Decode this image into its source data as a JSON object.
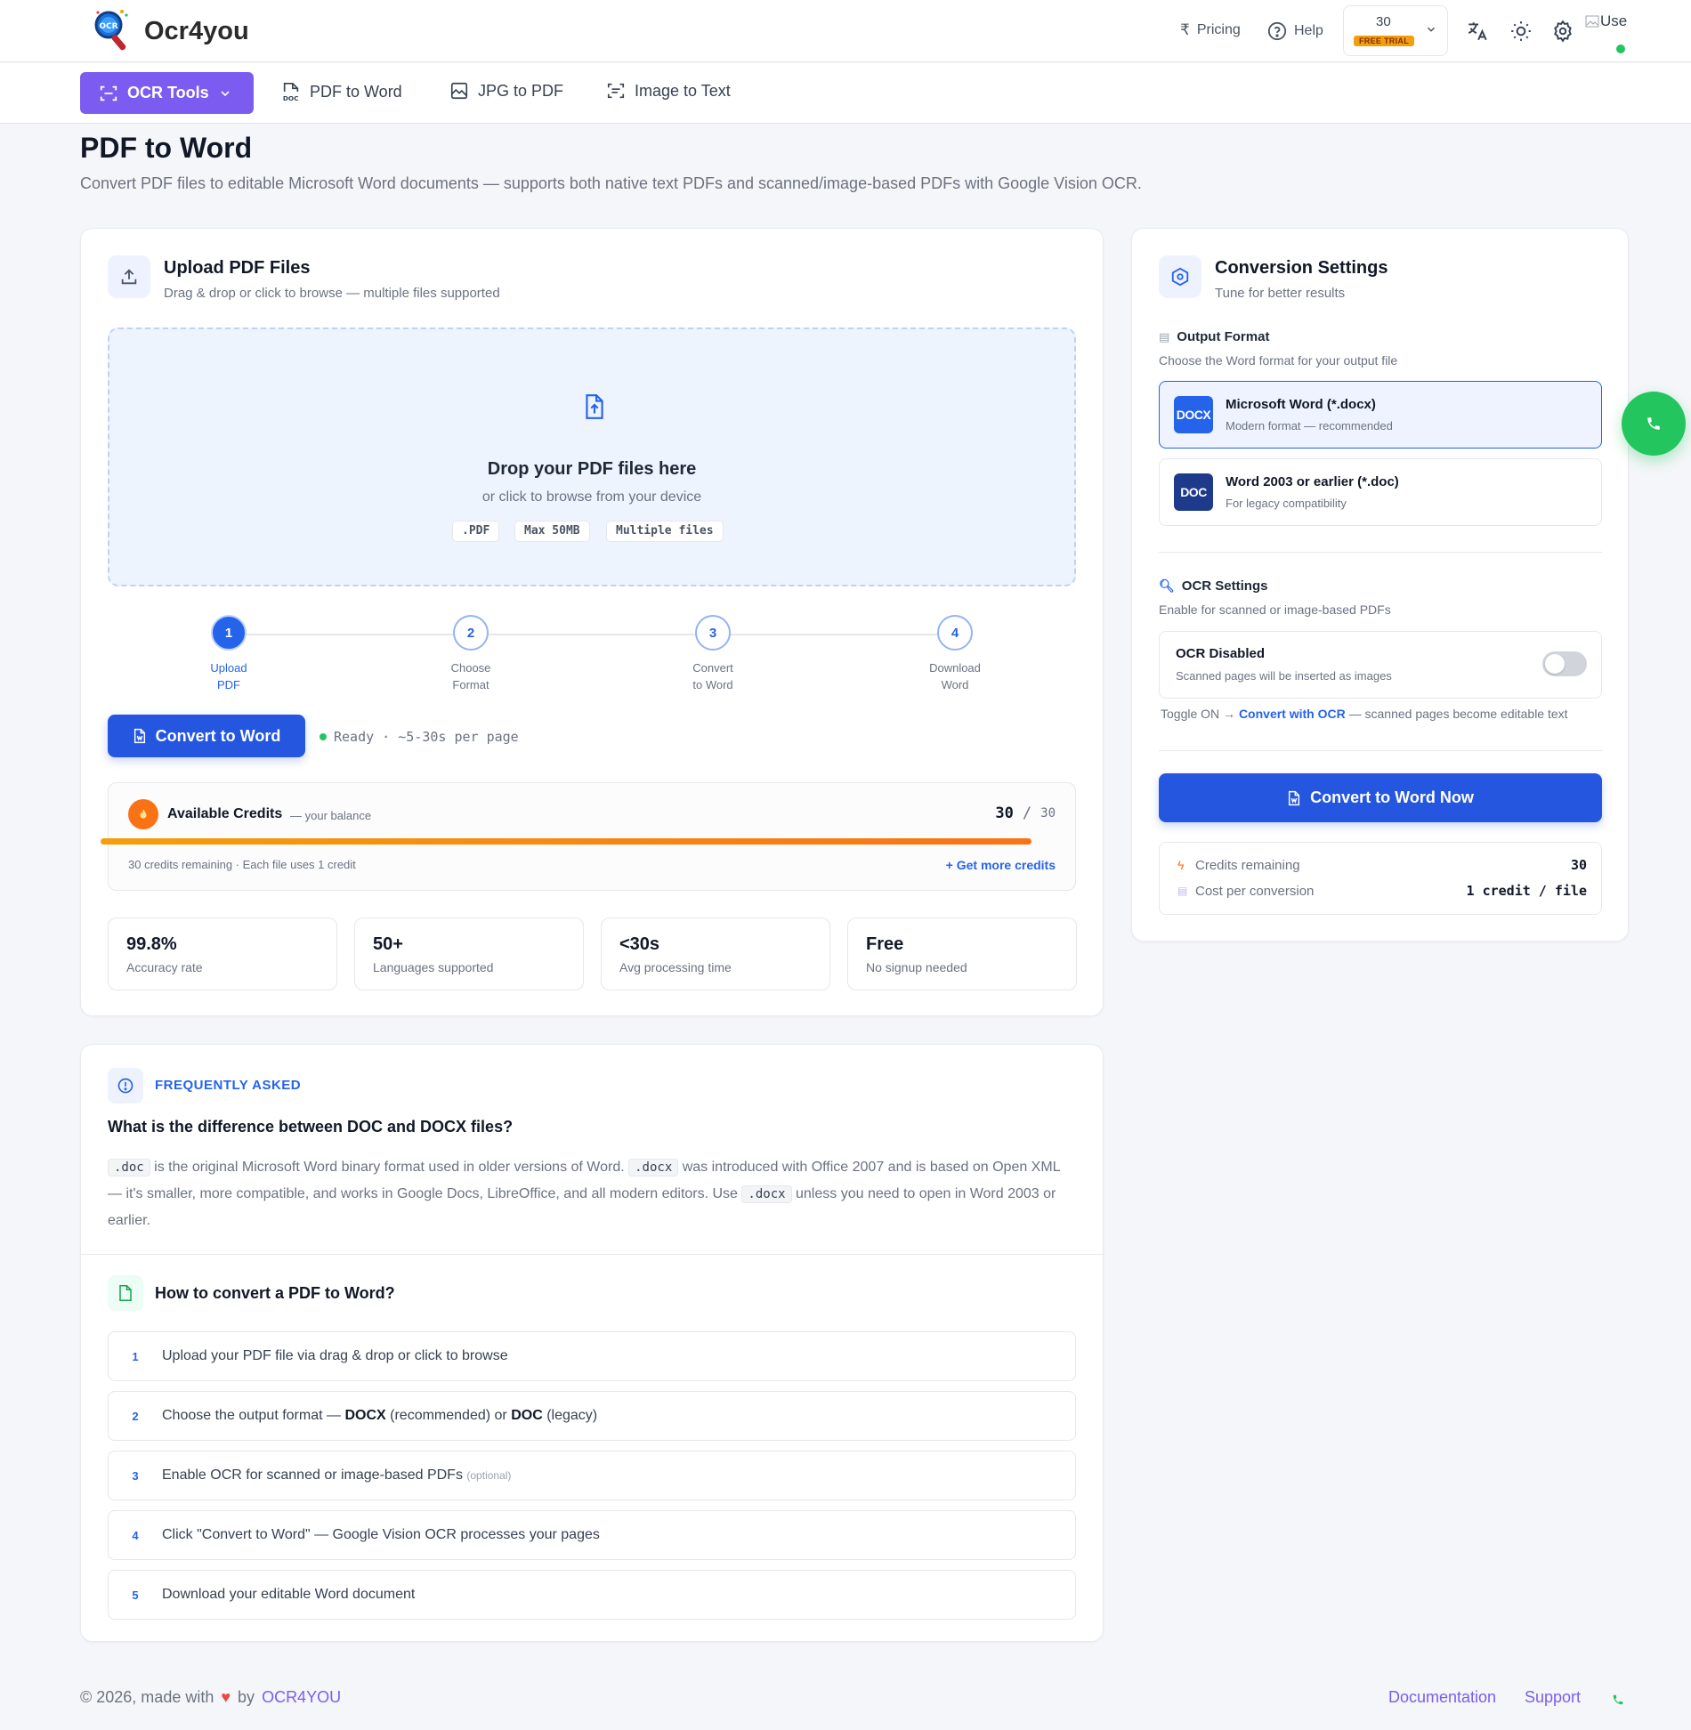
{
  "header": {
    "brand": "Ocr4you",
    "pricing": "Pricing",
    "help": "Help",
    "credits": "30",
    "trial_badge": "FREE TRIAL",
    "avatar_alt": "Use"
  },
  "nav": {
    "ocr_tools": "OCR Tools",
    "items": [
      "PDF to Word",
      "JPG to PDF",
      "Image to Text"
    ]
  },
  "page": {
    "title": "PDF to Word",
    "subtitle": "Convert PDF files to editable Microsoft Word documents — supports both native text PDFs and scanned/image-based PDFs with Google Vision OCR."
  },
  "upload": {
    "title": "Upload PDF Files",
    "subtitle": "Drag & drop or click to browse — multiple files supported",
    "drop_title": "Drop your PDF files here",
    "drop_sub": "or click to browse from your device",
    "chips": [
      ".PDF",
      "Max 50MB",
      "Multiple files"
    ],
    "steps": [
      {
        "num": "1",
        "l1": "Upload",
        "l2": "PDF"
      },
      {
        "num": "2",
        "l1": "Choose",
        "l2": "Format"
      },
      {
        "num": "3",
        "l1": "Convert",
        "l2": "to Word"
      },
      {
        "num": "4",
        "l1": "Download",
        "l2": "Word"
      }
    ],
    "convert_btn": "Convert to Word",
    "status": "Ready · ~5-30s per page"
  },
  "credits": {
    "title": "Available Credits",
    "subtitle": "— your balance",
    "current": "30",
    "separator": "/",
    "total": "30",
    "fill_fraction": 1.0,
    "note": "30 credits remaining · Each file uses 1 credit",
    "get_more": "+ Get more credits"
  },
  "stats": [
    {
      "value": "99.8%",
      "label": "Accuracy rate"
    },
    {
      "value": "50+",
      "label": "Languages supported"
    },
    {
      "value": "<30s",
      "label": "Avg processing time"
    },
    {
      "value": "Free",
      "label": "No signup needed"
    }
  ],
  "settings": {
    "title": "Conversion Settings",
    "subtitle": "Tune for better results",
    "output_title": "Output Format",
    "output_sub": "Choose the Word format for your output file",
    "formats": [
      {
        "badge": "DOCX",
        "title": "Microsoft Word (*.docx)",
        "sub": "Modern format — recommended",
        "color": "#2563eb"
      },
      {
        "badge": "DOC",
        "title": "Word 2003 or earlier (*.doc)",
        "sub": "For legacy compatibility",
        "color": "#1e3a8a"
      }
    ],
    "ocr_title": "OCR Settings",
    "ocr_sub": "Enable for scanned or image-based PDFs",
    "ocr_state": "OCR Disabled",
    "ocr_state_sub": "Scanned pages will be inserted as images",
    "hint_pre": "Toggle ON →",
    "hint_link": "Convert with OCR",
    "hint_post": "— scanned pages become editable text",
    "convert_now": "Convert to Word Now",
    "credits_label": "Credits remaining",
    "credits_value": "30",
    "cost_label": "Cost per conversion",
    "cost_value": "1 credit / file"
  },
  "faq": {
    "eyebrow": "FREQUENTLY ASKED",
    "question": "What is the difference between DOC and DOCX files?",
    "code_doc": ".doc",
    "code_docx": ".docx",
    "a1": " is the original Microsoft Word binary format used in older versions of Word. ",
    "a2": " was introduced with Office 2007 and is based on Open XML — it's smaller, more compatible, and works in Google Docs, LibreOffice, and all modern editors. Use ",
    "a3": " unless you need to open in Word 2003 or earlier.",
    "howto_title": "How to convert a PDF to Word?",
    "howto_steps": [
      {
        "n": "1",
        "text": "Upload your PDF file via drag & drop or click to browse"
      },
      {
        "n": "2",
        "pre": "Choose the output format — ",
        "b1": "DOCX",
        "mid": " (recommended) or ",
        "b2": "DOC",
        "post": " (legacy)"
      },
      {
        "n": "3",
        "text": "Enable OCR for scanned or image-based PDFs ",
        "small": "(optional)"
      },
      {
        "n": "4",
        "text": "Click \"Convert to Word\" — Google Vision OCR processes your pages"
      },
      {
        "n": "5",
        "text": "Download your editable Word document"
      }
    ]
  },
  "footer": {
    "copy": "© 2026, made with",
    "by": "by",
    "brand": "OCR4YOU",
    "documentation": "Documentation",
    "support": "Support"
  }
}
